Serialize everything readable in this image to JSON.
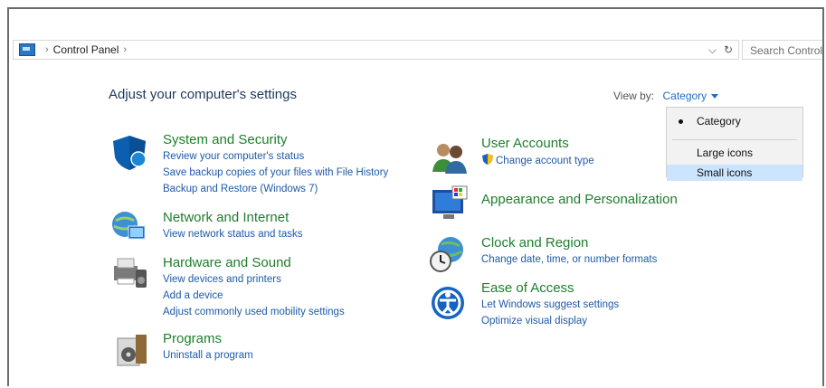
{
  "address_bar": {
    "path": [
      "Control Panel"
    ],
    "search_placeholder": "Search Control Panel"
  },
  "page": {
    "heading": "Adjust your computer's settings"
  },
  "view_by": {
    "label": "View by:",
    "selected": "Category",
    "options": [
      "Category",
      "Large icons",
      "Small icons"
    ],
    "highlighted_option": "Small icons"
  },
  "categories": {
    "system_security": {
      "title": "System and Security",
      "links": [
        "Review your computer's status",
        "Save backup copies of your files with File History",
        "Backup and Restore (Windows 7)"
      ]
    },
    "network": {
      "title": "Network and Internet",
      "links": [
        "View network status and tasks"
      ]
    },
    "hardware": {
      "title": "Hardware and Sound",
      "links": [
        "View devices and printers",
        "Add a device",
        "Adjust commonly used mobility settings"
      ]
    },
    "programs": {
      "title": "Programs",
      "links": [
        "Uninstall a program"
      ]
    },
    "user_accounts": {
      "title": "User Accounts",
      "links": [
        "Change account type"
      ]
    },
    "appearance": {
      "title": "Appearance and Personalization"
    },
    "clock": {
      "title": "Clock and Region",
      "links": [
        "Change date, time, or number formats"
      ]
    },
    "ease": {
      "title": "Ease of Access",
      "links": [
        "Let Windows suggest settings",
        "Optimize visual display"
      ]
    }
  },
  "colors": {
    "category_title": "#1e7f2c",
    "link": "#1e5aa8",
    "accent": "#1e6fc8",
    "hover": "#cce5ff"
  }
}
